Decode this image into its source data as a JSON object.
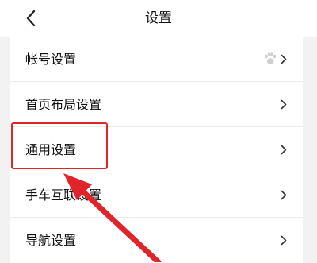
{
  "header": {
    "title": "设置",
    "back_icon": "chevron-left-icon"
  },
  "settings": {
    "items": [
      {
        "label": "帐号设置",
        "badge_icon": "paw-icon"
      },
      {
        "label": "首页布局设置"
      },
      {
        "label": "通用设置",
        "highlighted": true
      },
      {
        "label": "手车互联设置"
      },
      {
        "label": "导航设置"
      }
    ]
  },
  "annotation": {
    "color": "#e0252a",
    "target": "通用设置"
  }
}
